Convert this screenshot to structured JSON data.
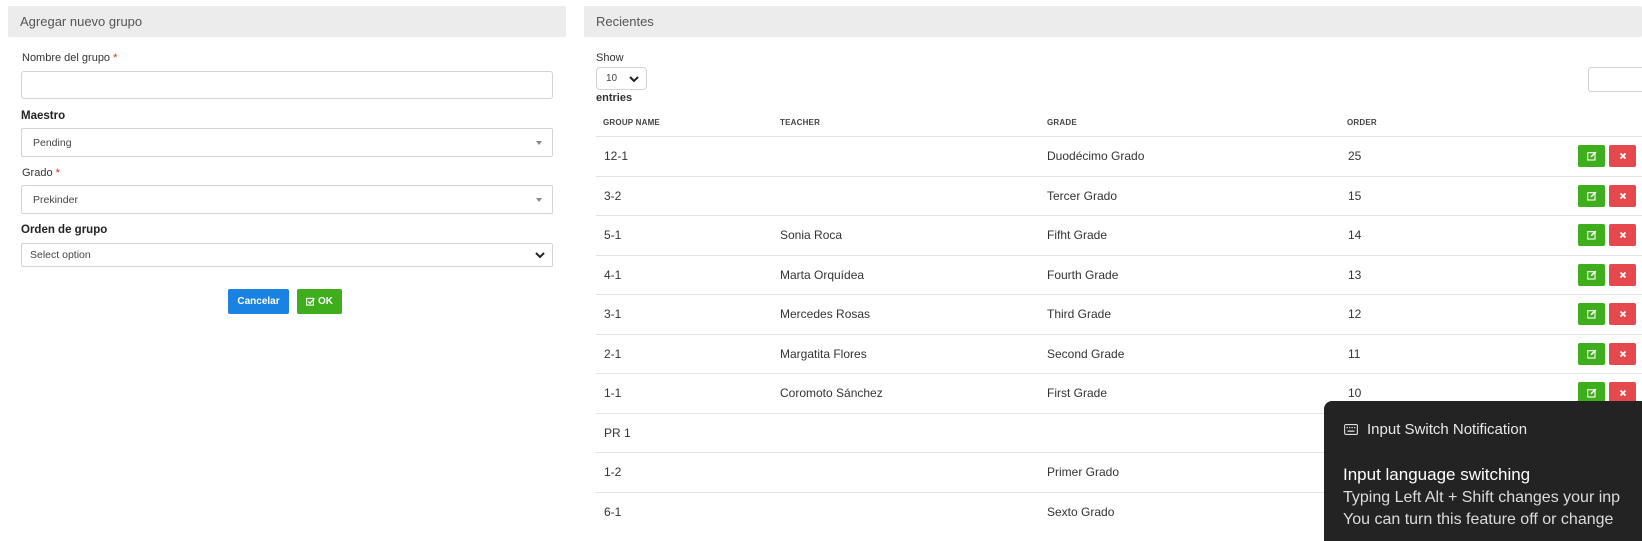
{
  "form": {
    "header": "Agregar nuevo grupo",
    "name_label": "Nombre del grupo",
    "name_value": "",
    "required_mark": "*",
    "teacher_label": "Maestro",
    "teacher_value": "Pending",
    "grade_label": "Grado",
    "grade_value": "Prekinder",
    "order_label": "Orden de grupo",
    "order_value": "Select option",
    "cancel_label": "Cancelar",
    "ok_label": "OK"
  },
  "recent": {
    "header": "Recientes",
    "show_label": "Show",
    "entries_value": "10",
    "entries_label": "entries",
    "columns": [
      "GROUP NAME",
      "TEACHER",
      "GRADE",
      "ORDER"
    ],
    "rows": [
      {
        "group": "12-1",
        "teacher": "",
        "grade": "Duodécimo Grado",
        "order": "25",
        "actions": true
      },
      {
        "group": "3-2",
        "teacher": "",
        "grade": "Tercer Grado",
        "order": "15",
        "actions": true
      },
      {
        "group": "5-1",
        "teacher": "Sonia Roca",
        "grade": "Fifht Grade",
        "order": "14",
        "actions": true
      },
      {
        "group": "4-1",
        "teacher": "Marta Orquídea",
        "grade": "Fourth Grade",
        "order": "13",
        "actions": true
      },
      {
        "group": "3-1",
        "teacher": "Mercedes Rosas",
        "grade": "Third Grade",
        "order": "12",
        "actions": true
      },
      {
        "group": "2-1",
        "teacher": "Margatita Flores",
        "grade": "Second Grade",
        "order": "11",
        "actions": true
      },
      {
        "group": "1-1",
        "teacher": "Coromoto Sánchez",
        "grade": "First Grade",
        "order": "10",
        "actions": true
      },
      {
        "group": "PR 1",
        "teacher": "",
        "grade": "",
        "order": "",
        "actions": false
      },
      {
        "group": "1-2",
        "teacher": "",
        "grade": "Primer Grado",
        "order": "",
        "actions": false
      },
      {
        "group": "6-1",
        "teacher": "",
        "grade": "Sexto Grado",
        "order": "",
        "actions": false
      }
    ]
  },
  "toast": {
    "app": "Input Switch Notification",
    "title": "Input language switching",
    "line1": "Typing Left Alt + Shift changes your inp",
    "line2": "You can turn this feature off or change"
  },
  "colors": {
    "primary": "#1a82e2",
    "success": "#3fae1d",
    "danger": "#e5484d",
    "required": "#e02424",
    "header_bg": "#ececec",
    "toast_bg": "#232323"
  },
  "icons": {
    "edit": "pencil-square-icon",
    "delete": "times-icon",
    "ok": "check-square-icon",
    "toast": "keyboard-icon"
  }
}
